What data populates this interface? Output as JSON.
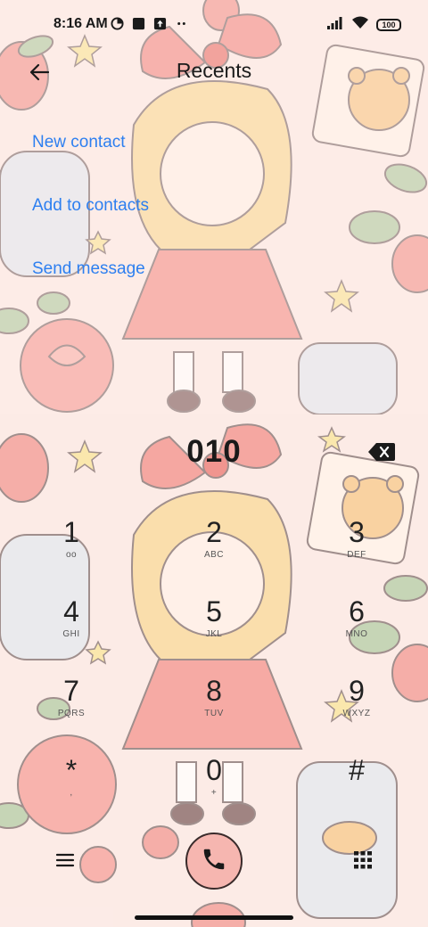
{
  "status_bar": {
    "time": "8:16 AM",
    "battery": "100",
    "left_icons": [
      "data-saver-icon",
      "square-app-icon",
      "upload-icon",
      "more-dots-icon"
    ],
    "right_icons": [
      "signal-icon",
      "wifi-icon",
      "battery-icon"
    ]
  },
  "header": {
    "title": "Recents",
    "back_icon": "back-arrow-icon"
  },
  "actions": [
    {
      "label": "New contact"
    },
    {
      "label": "Add to contacts"
    },
    {
      "label": "Send message"
    }
  ],
  "dialer": {
    "number": "010",
    "keys": [
      {
        "digit": "1",
        "letters": "oo"
      },
      {
        "digit": "2",
        "letters": "ABC"
      },
      {
        "digit": "3",
        "letters": "DEF"
      },
      {
        "digit": "4",
        "letters": "GHI"
      },
      {
        "digit": "5",
        "letters": "JKL"
      },
      {
        "digit": "6",
        "letters": "MNO"
      },
      {
        "digit": "7",
        "letters": "PQRS"
      },
      {
        "digit": "8",
        "letters": "TUV"
      },
      {
        "digit": "9",
        "letters": "WXYZ"
      },
      {
        "digit": "*",
        "letters": ","
      },
      {
        "digit": "0",
        "letters": "+"
      },
      {
        "digit": "#",
        "letters": ""
      }
    ]
  },
  "colors": {
    "link": "#2d7ff0",
    "background": "#fbe9e4",
    "call_button": "#f6b6b0"
  }
}
